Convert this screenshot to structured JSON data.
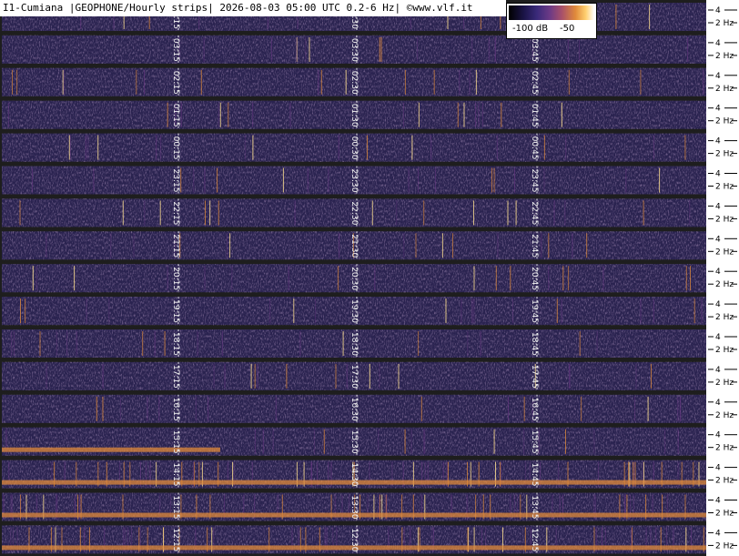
{
  "header": {
    "title": "I1-Cumiana |GEOPHONE/Hourly strips| 2026-08-03 05:00 UTC 0.2-6 Hz| ©www.vlf.it"
  },
  "colorbar": {
    "min_label": "-100 dB",
    "max_label": "-50"
  },
  "colors": {
    "background": "#2a2350",
    "low": "#1b1448",
    "mid": "#6c3a86",
    "high": "#e08a3a",
    "peak": "#ffe090",
    "separator": "#1e1e1e"
  },
  "chart_data": {
    "type": "heatmap",
    "title": "I1-Cumiana |GEOPHONE/Hourly strips| 2026-08-03 05:00 UTC 0.2-6 Hz| ©www.vlf.it",
    "y_unit": "Hz",
    "frequency_range_hz": [
      0.2,
      6
    ],
    "colorbar_range_db": [
      -100,
      -50
    ],
    "strip_y_ticks": [
      "4",
      "2 Hz"
    ],
    "strips": [
      {
        "hour": "04",
        "time_labels": [
          "04:15",
          "04:30",
          ""
        ]
      },
      {
        "hour": "03",
        "time_labels": [
          "03:15",
          "03:30",
          "03:45"
        ]
      },
      {
        "hour": "02",
        "time_labels": [
          "02:15",
          "02:30",
          "02:45"
        ]
      },
      {
        "hour": "01",
        "time_labels": [
          "01:15",
          "01:30",
          "01:45"
        ]
      },
      {
        "hour": "00",
        "time_labels": [
          "00:15",
          "00:30",
          "00:45"
        ]
      },
      {
        "hour": "23",
        "time_labels": [
          "23:15",
          "23:30",
          "23:45"
        ]
      },
      {
        "hour": "22",
        "time_labels": [
          "22:15",
          "22:30",
          "22:45"
        ]
      },
      {
        "hour": "21",
        "time_labels": [
          "21:15",
          "21:30",
          "21:45"
        ]
      },
      {
        "hour": "20",
        "time_labels": [
          "20:15",
          "20:30",
          "20:45"
        ]
      },
      {
        "hour": "19",
        "time_labels": [
          "19:15",
          "19:30",
          "19:45"
        ]
      },
      {
        "hour": "18",
        "time_labels": [
          "18:15",
          "18:30",
          "18:45"
        ]
      },
      {
        "hour": "17",
        "time_labels": [
          "17:15",
          "17:30",
          "17:45"
        ]
      },
      {
        "hour": "16",
        "time_labels": [
          "16:15",
          "16:30",
          "16:45"
        ]
      },
      {
        "hour": "15",
        "time_labels": [
          "15:15",
          "15:30",
          "15:45"
        ]
      },
      {
        "hour": "14",
        "time_labels": [
          "14:15",
          "14:30",
          "14:45"
        ]
      },
      {
        "hour": "13",
        "time_labels": [
          "13:15",
          "13:30",
          "13:45"
        ]
      },
      {
        "hour": "12",
        "time_labels": [
          "12:15",
          "12:30",
          "12:45"
        ]
      }
    ]
  }
}
